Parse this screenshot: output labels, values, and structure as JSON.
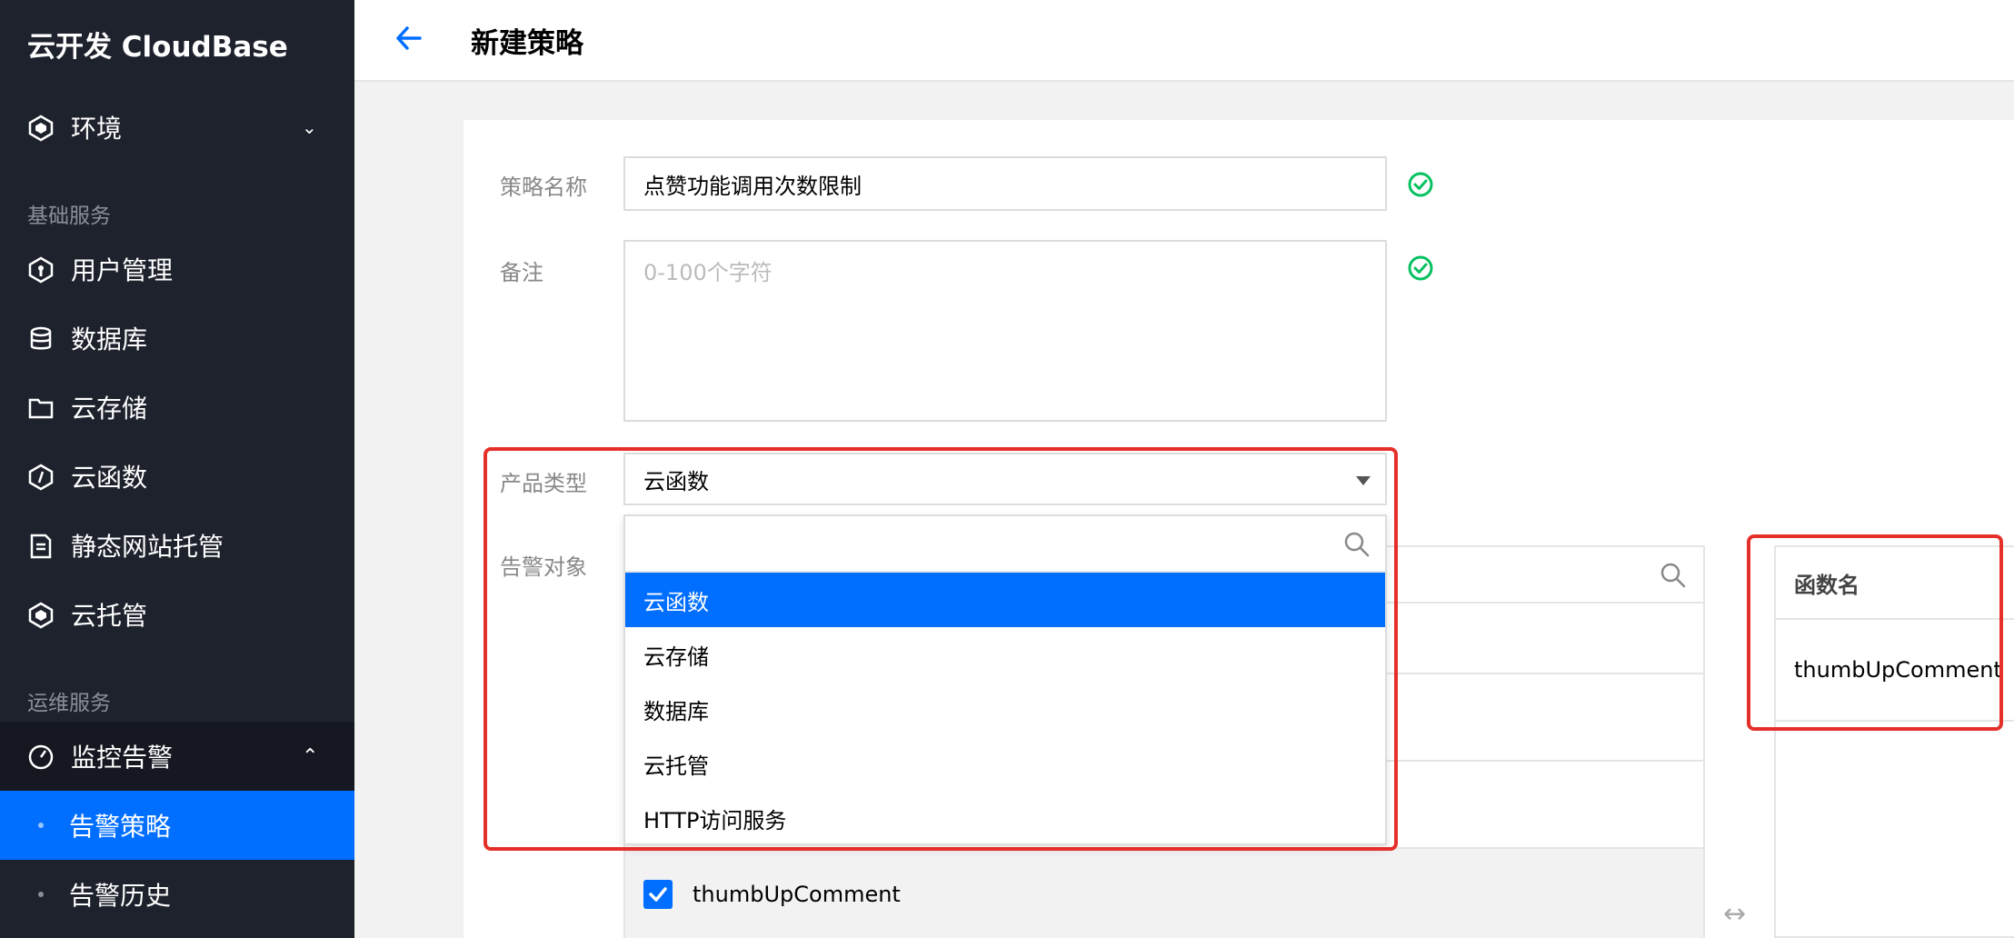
{
  "sidebar": {
    "brand": "云开发 CloudBase",
    "env_label": "环境",
    "section_basic": "基础服务",
    "items": [
      {
        "label": "用户管理"
      },
      {
        "label": "数据库"
      },
      {
        "label": "云存储"
      },
      {
        "label": "云函数"
      },
      {
        "label": "静态网站托管"
      },
      {
        "label": "云托管"
      }
    ],
    "section_ops": "运维服务",
    "monitor_label": "监控告警",
    "sub_items": [
      {
        "label": "告警策略",
        "active": true
      },
      {
        "label": "告警历史",
        "active": false
      }
    ]
  },
  "header": {
    "title": "新建策略"
  },
  "form": {
    "name_label": "策略名称",
    "name_value": "点赞功能调用次数限制",
    "note_label": "备注",
    "note_placeholder": "0-100个字符",
    "product_label": "产品类型",
    "product_value": "云函数",
    "target_label": "告警对象"
  },
  "dropdown": {
    "options": [
      {
        "label": "云函数",
        "selected": true
      },
      {
        "label": "云存储",
        "selected": false
      },
      {
        "label": "数据库",
        "selected": false
      },
      {
        "label": "云托管",
        "selected": false
      },
      {
        "label": "HTTP访问服务",
        "selected": false
      }
    ]
  },
  "function_list": {
    "selected_item": "thumbUpComment"
  },
  "selected_table": {
    "column_header": "函数名",
    "rows": [
      "thumbUpComment"
    ]
  },
  "colors": {
    "accent": "#006eff",
    "sidebar_bg": "#1e222d",
    "highlight": "#e5302a",
    "success": "#07c160"
  }
}
